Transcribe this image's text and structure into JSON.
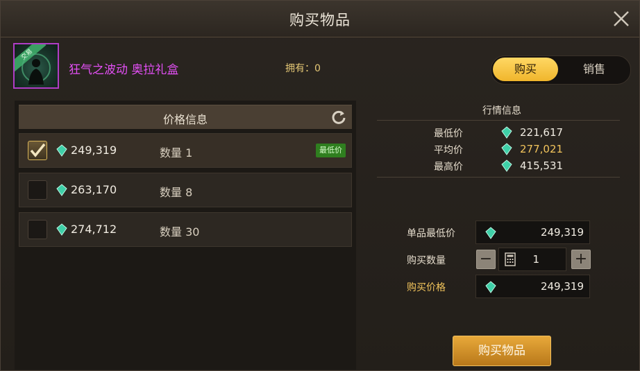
{
  "dialog": {
    "title": "购买物品"
  },
  "item": {
    "name": "狂气之波动 奥拉礼盒",
    "icon_tag": "交易",
    "owned_label": "拥有：0"
  },
  "trade_toggle": {
    "buy": "购买",
    "sell": "销售",
    "active": "购买"
  },
  "price_info": {
    "header": "价格信息",
    "listings": [
      {
        "price": "249,319",
        "quantity": "数量 1",
        "badge": "最低价",
        "checked": true
      },
      {
        "price": "263,170",
        "quantity": "数量 8",
        "badge": "",
        "checked": false
      },
      {
        "price": "274,712",
        "quantity": "数量 30",
        "badge": "",
        "checked": false
      }
    ]
  },
  "market": {
    "title": "行情信息",
    "lowest_label": "最低价",
    "lowest_value": "221,617",
    "average_label": "平均价",
    "average_value": "277,021",
    "highest_label": "最高价",
    "highest_value": "415,531"
  },
  "order": {
    "unit_min_label": "单品最低价",
    "unit_min_value": "249,319",
    "quantity_label": "购买数量",
    "quantity_value": "1",
    "total_label": "购买价格",
    "total_value": "249,319",
    "minus": "−",
    "plus": "+"
  },
  "buy_button": {
    "label": "购买物品"
  },
  "colors": {
    "accent_gold": "#f0b62c",
    "item_name": "#e34ff5",
    "gem": "#3fd0a8"
  },
  "icons": [
    "close-icon",
    "refresh-icon",
    "gem-icon",
    "check-icon",
    "calculator-icon",
    "minus-icon",
    "plus-icon"
  ]
}
